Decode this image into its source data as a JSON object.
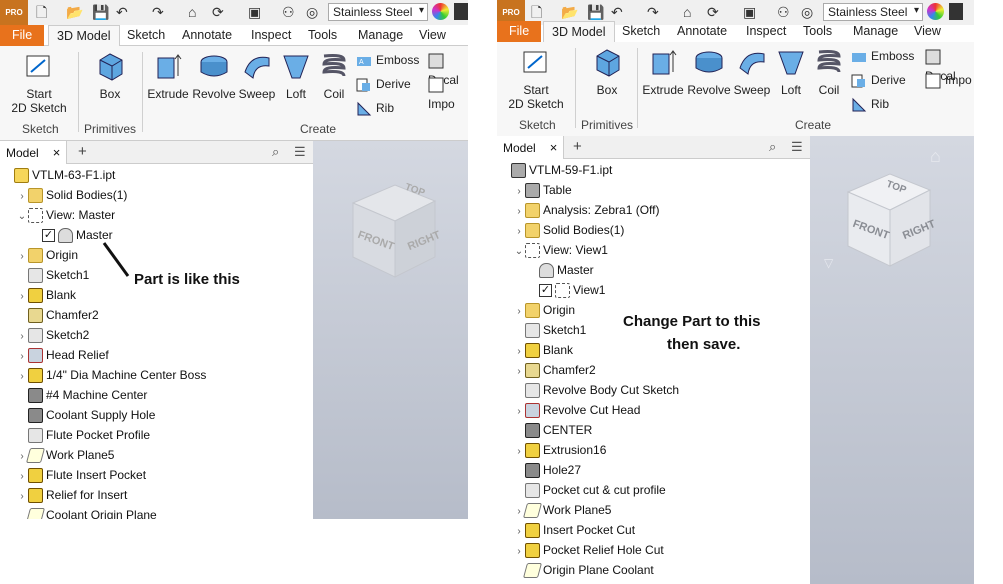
{
  "quick_access": {
    "material": "Stainless Steel",
    "logo_text": "PRO"
  },
  "tabs": [
    {
      "label": "File"
    },
    {
      "label": "3D Model"
    },
    {
      "label": "Sketch"
    },
    {
      "label": "Annotate"
    },
    {
      "label": "Inspect"
    },
    {
      "label": "Tools"
    },
    {
      "label": "Manage"
    },
    {
      "label": "View"
    }
  ],
  "ribbon": {
    "start_sketch": "Start\n2D Sketch",
    "box": "Box",
    "create": [
      "Extrude",
      "Revolve",
      "Sweep",
      "Loft",
      "Coil"
    ],
    "small": [
      "Emboss",
      "Derive",
      "Rib"
    ],
    "groups": {
      "sketch": "Sketch",
      "primitives": "Primitives",
      "create": "Create"
    }
  },
  "browser": {
    "tab_label": "Model",
    "close": "×",
    "plus": "+"
  },
  "left_panel": {
    "cube_faces": {
      "top": "TOP",
      "front": "FRONT",
      "right": "RIGHT"
    },
    "annotation": "Part is like this",
    "tree": [
      {
        "label": "VTLM-63-F1.ipt",
        "icon": "part",
        "indent": 0,
        "expander": ""
      },
      {
        "label": "Solid Bodies(1)",
        "icon": "folder",
        "indent": 1,
        "expander": "›"
      },
      {
        "label": "View: Master",
        "icon": "view",
        "indent": 1,
        "expander": "⌄"
      },
      {
        "label": "Master",
        "icon": "lock",
        "indent": 2,
        "expander": "",
        "checkbox": true
      },
      {
        "label": "Origin",
        "icon": "folder",
        "indent": 1,
        "expander": "›"
      },
      {
        "label": "Sketch1",
        "icon": "sketch",
        "indent": 1,
        "expander": ""
      },
      {
        "label": "Blank",
        "icon": "feature",
        "indent": 1,
        "expander": "›"
      },
      {
        "label": "Chamfer2",
        "icon": "chamfer",
        "indent": 1,
        "expander": ""
      },
      {
        "label": "Sketch2",
        "icon": "sketch",
        "indent": 1,
        "expander": "›"
      },
      {
        "label": "Head Relief",
        "icon": "cut",
        "indent": 1,
        "expander": "›"
      },
      {
        "label": "1/4\" Dia Machine Center Boss",
        "icon": "feature",
        "indent": 1,
        "expander": "›"
      },
      {
        "label": "#4 Machine Center",
        "icon": "hole",
        "indent": 1,
        "expander": ""
      },
      {
        "label": "Coolant Supply Hole",
        "icon": "hole",
        "indent": 1,
        "expander": ""
      },
      {
        "label": "Flute Pocket Profile",
        "icon": "sketch",
        "indent": 1,
        "expander": ""
      },
      {
        "label": "Work Plane5",
        "icon": "plane",
        "indent": 1,
        "expander": "›"
      },
      {
        "label": "Flute Insert Pocket",
        "icon": "feature",
        "indent": 1,
        "expander": "›"
      },
      {
        "label": "Relief for Insert",
        "icon": "feature",
        "indent": 1,
        "expander": "›"
      },
      {
        "label": "Coolant Origin Plane",
        "icon": "plane",
        "indent": 1,
        "expander": ""
      }
    ]
  },
  "right_panel": {
    "cube_faces": {
      "top": "TOP",
      "front": "FRONT",
      "right": "RIGHT"
    },
    "annotation": [
      "Change Part to this",
      "then save."
    ],
    "small_extra": [
      "Decal",
      "Impo"
    ],
    "tree": [
      {
        "label": "VTLM-59-F1.ipt",
        "icon": "table",
        "indent": 0,
        "expander": ""
      },
      {
        "label": "Table",
        "icon": "table",
        "indent": 1,
        "expander": "›"
      },
      {
        "label": "Analysis: Zebra1 (Off)",
        "icon": "folder",
        "indent": 1,
        "expander": "›"
      },
      {
        "label": "Solid Bodies(1)",
        "icon": "folder",
        "indent": 1,
        "expander": "›"
      },
      {
        "label": "View: View1",
        "icon": "view",
        "indent": 1,
        "expander": "⌄"
      },
      {
        "label": "Master",
        "icon": "lock",
        "indent": 2,
        "expander": ""
      },
      {
        "label": "View1",
        "icon": "view",
        "indent": 2,
        "expander": "",
        "checkbox": true
      },
      {
        "label": "Origin",
        "icon": "folder",
        "indent": 1,
        "expander": "›"
      },
      {
        "label": "Sketch1",
        "icon": "sketch",
        "indent": 1,
        "expander": ""
      },
      {
        "label": "Blank",
        "icon": "feature",
        "indent": 1,
        "expander": "›"
      },
      {
        "label": "Chamfer2",
        "icon": "chamfer",
        "indent": 1,
        "expander": "›"
      },
      {
        "label": "Revolve Body Cut Sketch",
        "icon": "sketch",
        "indent": 1,
        "expander": ""
      },
      {
        "label": "Revolve Cut Head",
        "icon": "cut",
        "indent": 1,
        "expander": "›"
      },
      {
        "label": "CENTER",
        "icon": "hole",
        "indent": 1,
        "expander": ""
      },
      {
        "label": "Extrusion16",
        "icon": "feature",
        "indent": 1,
        "expander": "›"
      },
      {
        "label": "Hole27",
        "icon": "hole",
        "indent": 1,
        "expander": ""
      },
      {
        "label": "Pocket cut & cut profile",
        "icon": "sketch",
        "indent": 1,
        "expander": ""
      },
      {
        "label": "Work Plane5",
        "icon": "plane",
        "indent": 1,
        "expander": "›"
      },
      {
        "label": "Insert Pocket Cut",
        "icon": "feature",
        "indent": 1,
        "expander": "›"
      },
      {
        "label": "Pocket Relief Hole Cut",
        "icon": "feature",
        "indent": 1,
        "expander": "›"
      },
      {
        "label": "Origin Plane Coolant",
        "icon": "plane",
        "indent": 1,
        "expander": ""
      }
    ]
  }
}
